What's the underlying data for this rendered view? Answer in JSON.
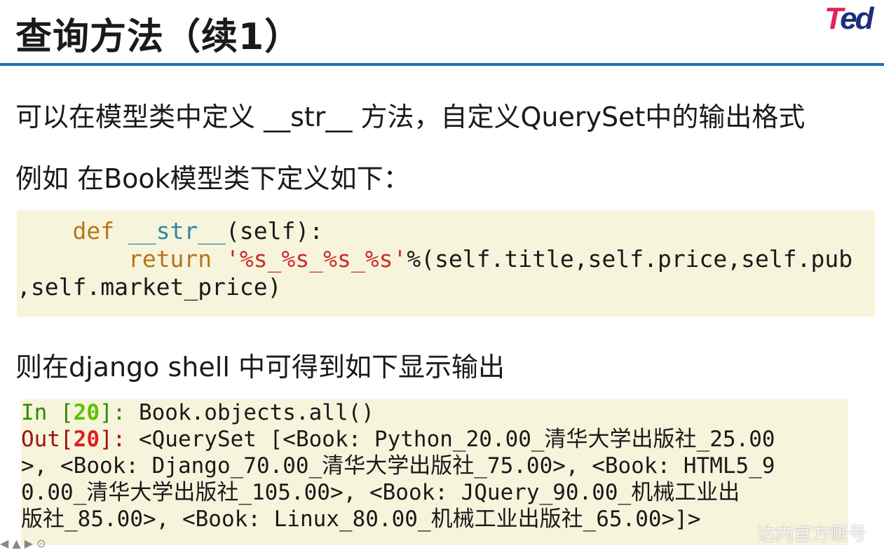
{
  "title": "查询方法（续1）",
  "logo": {
    "t": "T",
    "ed": "ed"
  },
  "paragraphs": [
    "可以在模型类中定义 __str__ 方法，自定义QuerySet中的输出格式",
    "例如 在Book模型类下定义如下：",
    "则在django shell 中可得到如下显示输出"
  ],
  "code": {
    "indent1": "    ",
    "def": "def",
    "sp": " ",
    "fn": "__str__",
    "sig": "(self):",
    "indent2": "        ",
    "ret": "return",
    "sp2": " ",
    "str": "'%s_%s_%s_%s'",
    "rest": "%(self.title,self.price,self.pub",
    "line3": ",self.market_price)"
  },
  "shell": {
    "in_label": "In [",
    "in_num": "20",
    "in_close": "]: ",
    "in_cmd": "Book.objects.all()",
    "out_label": "Out[",
    "out_num": "20",
    "out_close": "]: ",
    "out_lines": [
      "<QuerySet [<Book: Python_20.00_清华大学出版社_25.00",
      ">, <Book: Django_70.00_清华大学出版社_75.00>, <Book: HTML5_9",
      "0.00_清华大学出版社_105.00>, <Book: JQuery_90.00_机械工业出",
      "版社_85.00>, <Book: Linux_80.00_机械工业出版社_65.00>]>"
    ]
  },
  "watermark": "达内官方账号"
}
